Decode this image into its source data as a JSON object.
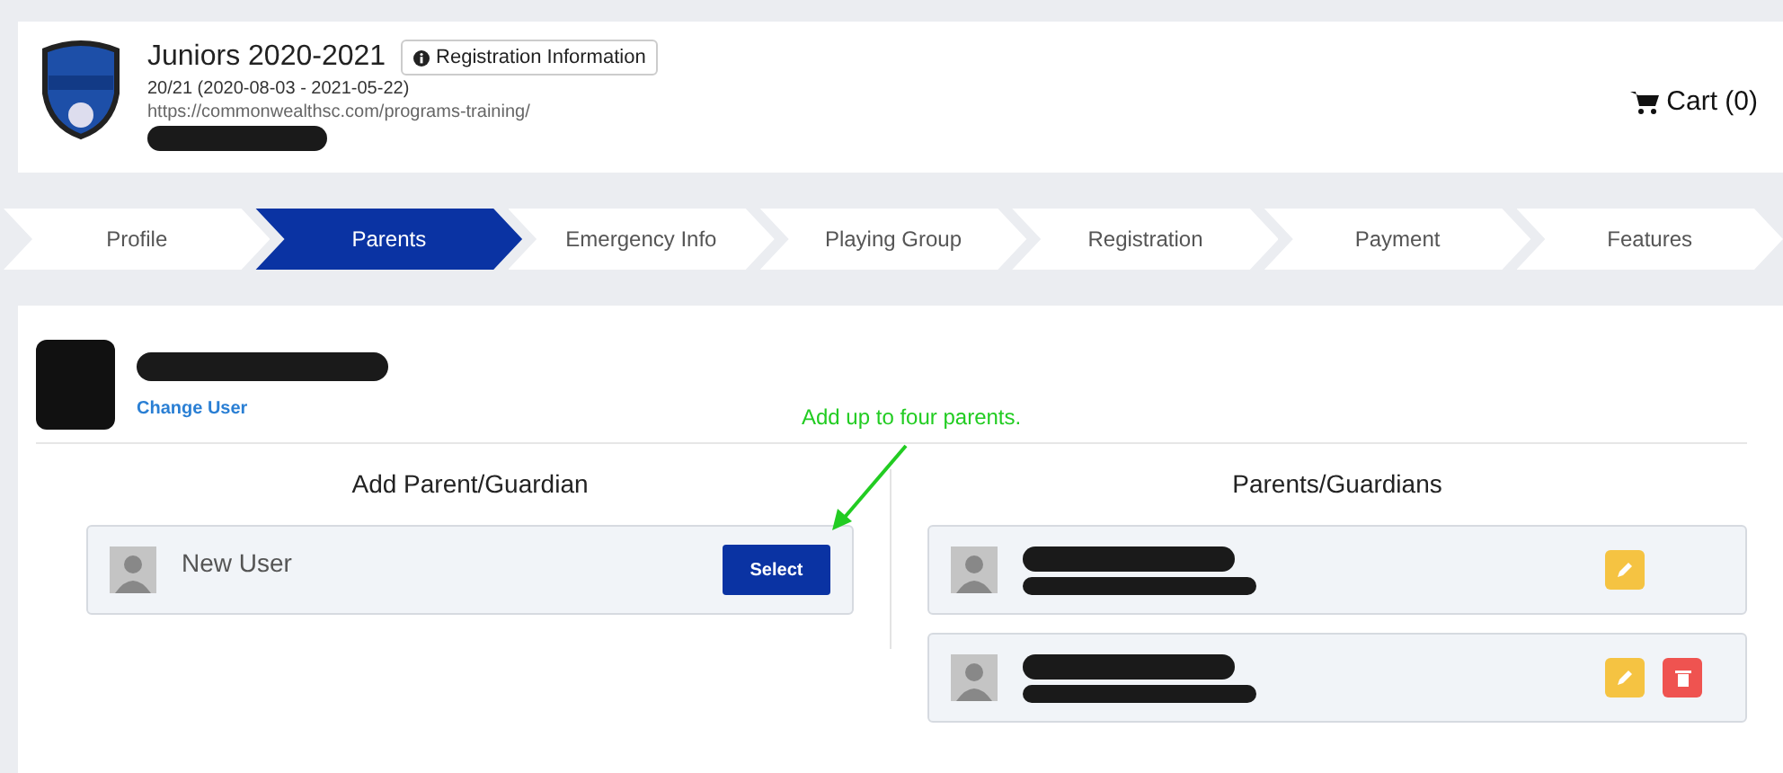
{
  "header": {
    "title": "Juniors 2020-2021",
    "info_button": "Registration Information",
    "season": "20/21 (2020-08-03 - 2021-05-22)",
    "url": "https://commonwealthsc.com/programs-training/",
    "cart": "Cart (0)"
  },
  "steps": [
    {
      "label": "Profile",
      "selected": false
    },
    {
      "label": "Parents",
      "selected": true
    },
    {
      "label": "Emergency Info",
      "selected": false
    },
    {
      "label": "Playing Group",
      "selected": false
    },
    {
      "label": "Registration",
      "selected": false
    },
    {
      "label": "Payment",
      "selected": false
    },
    {
      "label": "Features",
      "selected": false
    }
  ],
  "user": {
    "change_link": "Change User"
  },
  "annotation": "Add up to four parents.",
  "add_panel": {
    "title": "Add Parent/Guardian",
    "new_user": "New User",
    "select_button": "Select"
  },
  "list_panel": {
    "title": "Parents/Guardians",
    "parents": [
      {
        "deletable": false
      },
      {
        "deletable": true
      }
    ]
  }
}
